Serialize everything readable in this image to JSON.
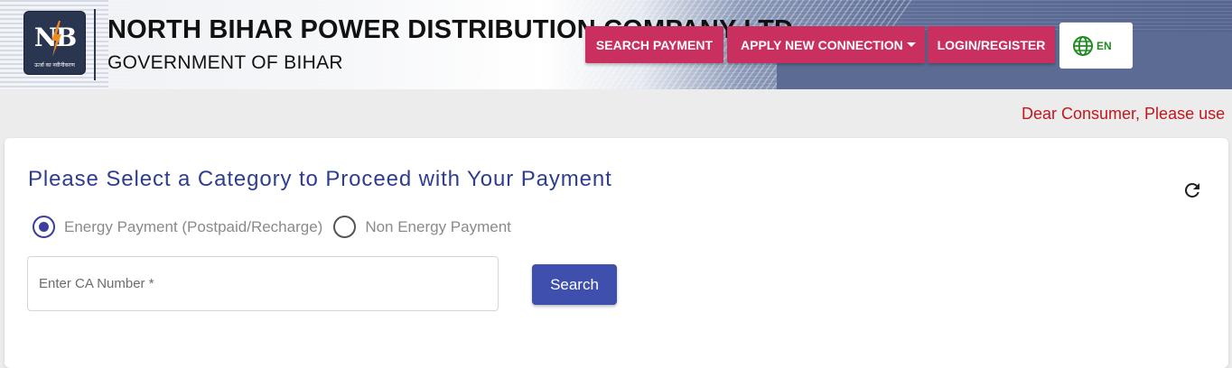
{
  "header": {
    "logo_letters": "NB",
    "logo_tagline": "ऊर्जा का नवीनीकरण",
    "company_name": "NORTH BIHAR POWER DISTRIBUTION COMPANY LTD.",
    "government": "GOVERNMENT OF BIHAR"
  },
  "nav": {
    "search_payment": "SEARCH PAYMENT",
    "apply_new_connection": "APPLY NEW CONNECTION",
    "login_register": "LOGIN/REGISTER",
    "language": "EN"
  },
  "notice": {
    "text": "Dear Consumer, Please use"
  },
  "payment_card": {
    "title": "Please Select a Category to Proceed with Your Payment",
    "options": [
      {
        "label": "Energy Payment (Postpaid/Recharge)",
        "selected": true
      },
      {
        "label": "Non Energy Payment",
        "selected": false
      }
    ],
    "ca_input": {
      "placeholder": "Enter CA Number *",
      "value": ""
    },
    "search_label": "Search"
  },
  "colors": {
    "nav_button": "#c9305f",
    "primary": "#3f4fad",
    "title": "#2f3d8f",
    "notice": "#c4161c",
    "language_icon": "#1f8a1f"
  },
  "icons": [
    "lightning-bolt-icon",
    "globe-icon",
    "chevron-down-icon",
    "refresh-icon"
  ]
}
